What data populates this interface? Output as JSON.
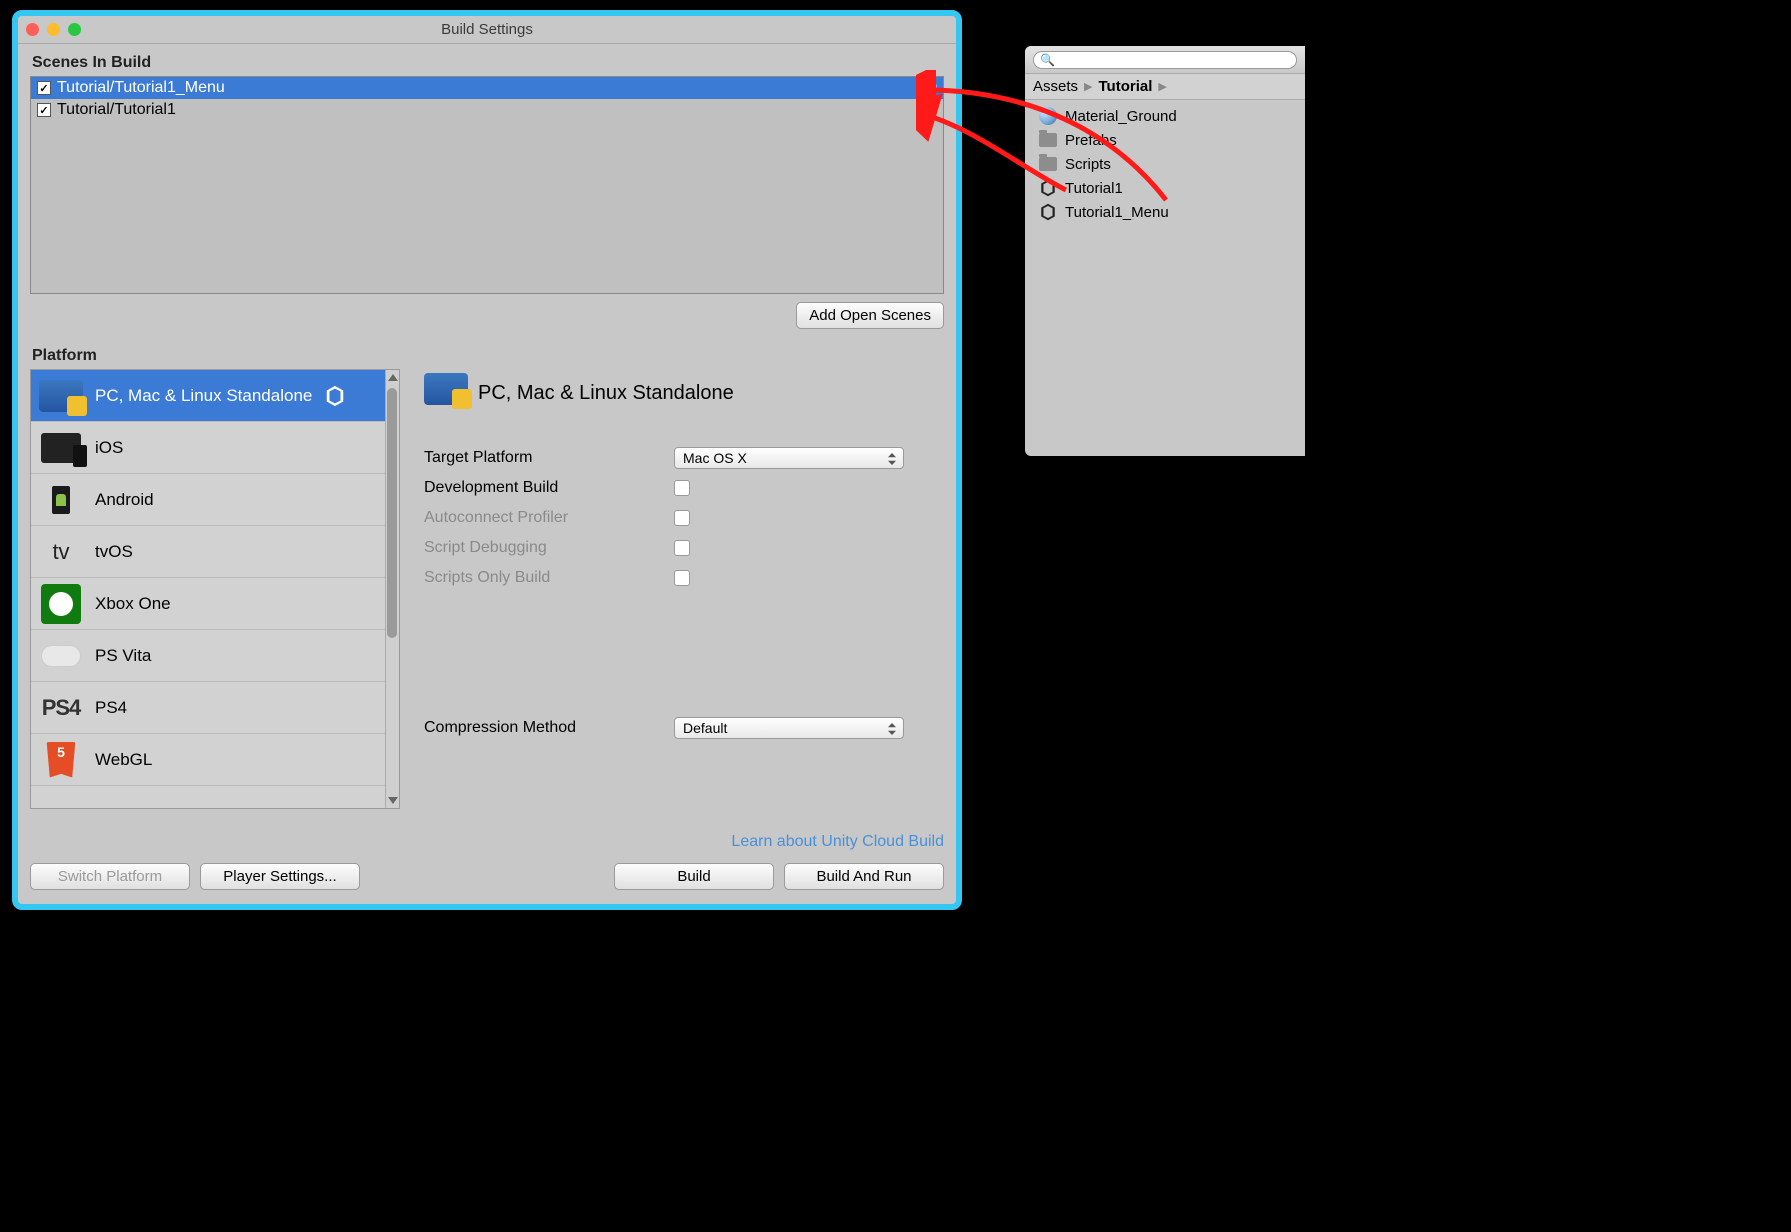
{
  "window": {
    "title": "Build Settings"
  },
  "scenes": {
    "label": "Scenes In Build",
    "items": [
      {
        "name": "Tutorial/Tutorial1_Menu",
        "index": "0",
        "selected": true
      },
      {
        "name": "Tutorial/Tutorial1",
        "index": "1",
        "selected": false
      }
    ],
    "add_button": "Add Open Scenes"
  },
  "platform": {
    "label": "Platform",
    "items": [
      {
        "name": "PC, Mac & Linux Standalone",
        "icon": "desktop",
        "selected": true,
        "current": true
      },
      {
        "name": "iOS",
        "icon": "ios"
      },
      {
        "name": "Android",
        "icon": "android"
      },
      {
        "name": "tvOS",
        "icon": "tvos"
      },
      {
        "name": "Xbox One",
        "icon": "xbox"
      },
      {
        "name": "PS Vita",
        "icon": "psvita"
      },
      {
        "name": "PS4",
        "icon": "ps4"
      },
      {
        "name": "WebGL",
        "icon": "webgl"
      }
    ]
  },
  "detail": {
    "title": "PC, Mac & Linux Standalone",
    "rows": {
      "target_label": "Target Platform",
      "target_value": "Mac OS X",
      "dev_label": "Development Build",
      "auto_label": "Autoconnect Profiler",
      "script_dbg_label": "Script Debugging",
      "scripts_only_label": "Scripts Only Build",
      "compression_label": "Compression Method",
      "compression_value": "Default"
    },
    "cloud_link": "Learn about Unity Cloud Build"
  },
  "buttons": {
    "switch": "Switch Platform",
    "player": "Player Settings...",
    "build": "Build",
    "build_run": "Build And Run"
  },
  "project": {
    "search_placeholder": "",
    "crumb_root": "Assets",
    "crumb_cur": "Tutorial",
    "items": [
      {
        "name": "Material_Ground",
        "icon": "material"
      },
      {
        "name": "Prefabs",
        "icon": "folder"
      },
      {
        "name": "Scripts",
        "icon": "folder"
      },
      {
        "name": "Tutorial1",
        "icon": "scene"
      },
      {
        "name": "Tutorial1_Menu",
        "icon": "scene"
      }
    ]
  }
}
